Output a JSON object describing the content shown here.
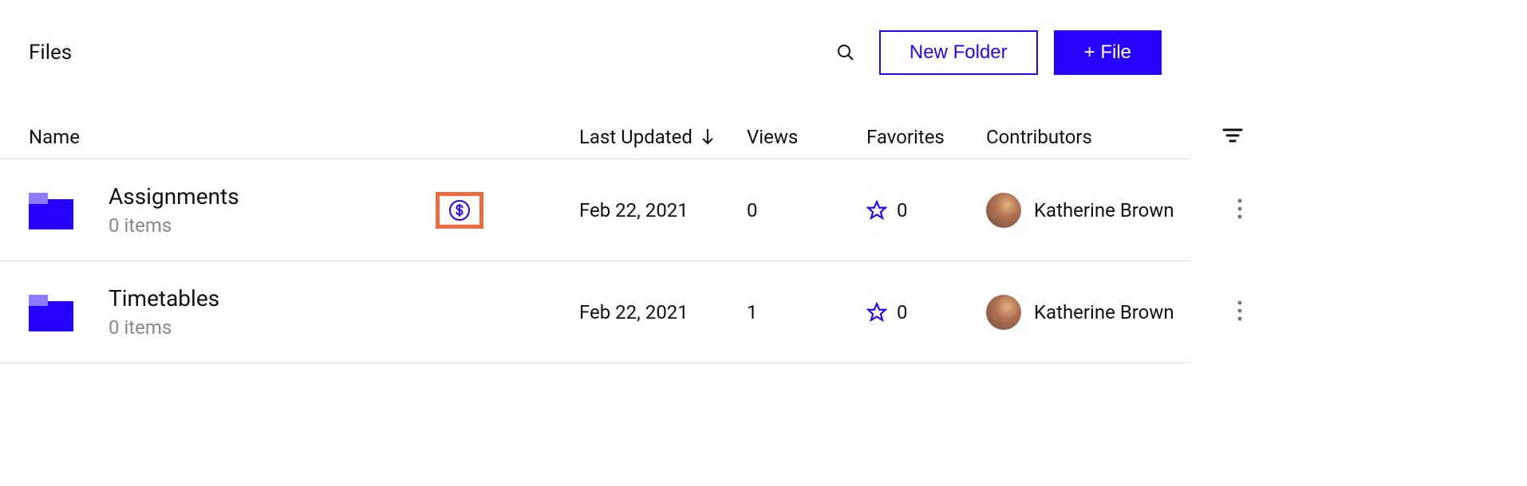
{
  "header": {
    "title": "Files",
    "new_folder_label": "New Folder",
    "add_file_label": "+ File"
  },
  "columns": {
    "name": "Name",
    "last_updated": "Last Updated",
    "views": "Views",
    "favorites": "Favorites",
    "contributors": "Contributors"
  },
  "sort": {
    "column": "last_updated",
    "direction": "desc"
  },
  "rows": [
    {
      "name": "Assignments",
      "subtitle": "0 items",
      "has_dollar_badge": true,
      "last_updated": "Feb 22, 2021",
      "views": "0",
      "favorites": "0",
      "contributor": "Katherine Brown"
    },
    {
      "name": "Timetables",
      "subtitle": "0 items",
      "has_dollar_badge": false,
      "last_updated": "Feb 22, 2021",
      "views": "1",
      "favorites": "0",
      "contributor": "Katherine Brown"
    }
  ],
  "colors": {
    "accent": "#2602ff",
    "badge_border": "#f36a3e"
  }
}
